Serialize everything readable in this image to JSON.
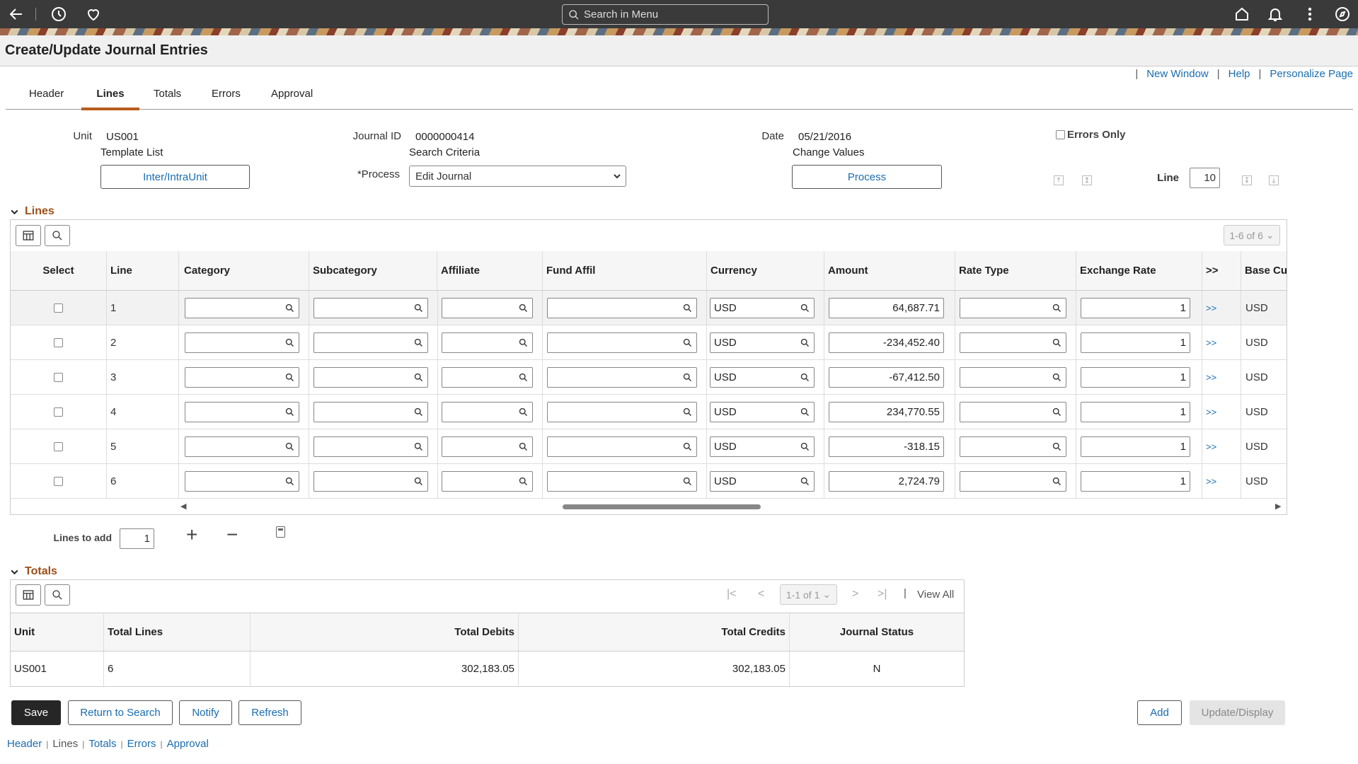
{
  "topbar": {
    "search_placeholder": "Search in Menu"
  },
  "page": {
    "title": "Create/Update Journal Entries"
  },
  "toplinks": {
    "sep": "|",
    "new_window": "New Window",
    "help": "Help",
    "personalize": "Personalize Page"
  },
  "tabs": [
    {
      "label": "Header"
    },
    {
      "label": "Lines"
    },
    {
      "label": "Totals"
    },
    {
      "label": "Errors"
    },
    {
      "label": "Approval"
    }
  ],
  "header": {
    "unit_label": "Unit",
    "unit_value": "US001",
    "template_list": "Template List",
    "inter_btn": "Inter/IntraUnit",
    "journal_id_label": "Journal ID",
    "journal_id_value": "0000000414",
    "search_criteria": "Search Criteria",
    "process_label": "*Process",
    "process_value": "Edit Journal",
    "date_label": "Date",
    "date_value": "05/21/2016",
    "change_values": "Change Values",
    "process_btn": "Process",
    "errors_only": "Errors Only",
    "line_label": "Line",
    "line_value": "10"
  },
  "lines": {
    "section_title": "Lines",
    "pager": "1-6 of 6",
    "columns": [
      "Select",
      "Line",
      "Category",
      "Subcategory",
      "Affiliate",
      "Fund Affil",
      "Currency",
      "Amount",
      "Rate Type",
      "Exchange Rate",
      ">>",
      "Base Cu"
    ],
    "rows": [
      {
        "line": "1",
        "currency": "USD",
        "amount": "64,687.71",
        "rate": "1",
        "more": ">>",
        "base": "USD"
      },
      {
        "line": "2",
        "currency": "USD",
        "amount": "-234,452.40",
        "rate": "1",
        "more": ">>",
        "base": "USD"
      },
      {
        "line": "3",
        "currency": "USD",
        "amount": "-67,412.50",
        "rate": "1",
        "more": ">>",
        "base": "USD"
      },
      {
        "line": "4",
        "currency": "USD",
        "amount": "234,770.55",
        "rate": "1",
        "more": ">>",
        "base": "USD"
      },
      {
        "line": "5",
        "currency": "USD",
        "amount": "-318.15",
        "rate": "1",
        "more": ">>",
        "base": "USD"
      },
      {
        "line": "6",
        "currency": "USD",
        "amount": "2,724.79",
        "rate": "1",
        "more": ">>",
        "base": "USD"
      }
    ],
    "lines_to_add_label": "Lines to add",
    "lines_to_add_value": "1"
  },
  "totals": {
    "section_title": "Totals",
    "pager": "1-1 of 1",
    "view_all": "View All",
    "columns": [
      "Unit",
      "Total Lines",
      "Total Debits",
      "Total Credits",
      "Journal Status"
    ],
    "row": {
      "unit": "US001",
      "total_lines": "6",
      "debits": "302,183.05",
      "credits": "302,183.05",
      "status": "N"
    }
  },
  "actions": {
    "save": "Save",
    "return": "Return to Search",
    "notify": "Notify",
    "refresh": "Refresh",
    "add": "Add",
    "update": "Update/Display"
  },
  "bottom_links": [
    "Header",
    "Lines",
    "Totals",
    "Errors",
    "Approval"
  ],
  "colors": {
    "accent": "#b85c1e",
    "link": "#1a6dae",
    "topbar": "#3a3a3a"
  }
}
